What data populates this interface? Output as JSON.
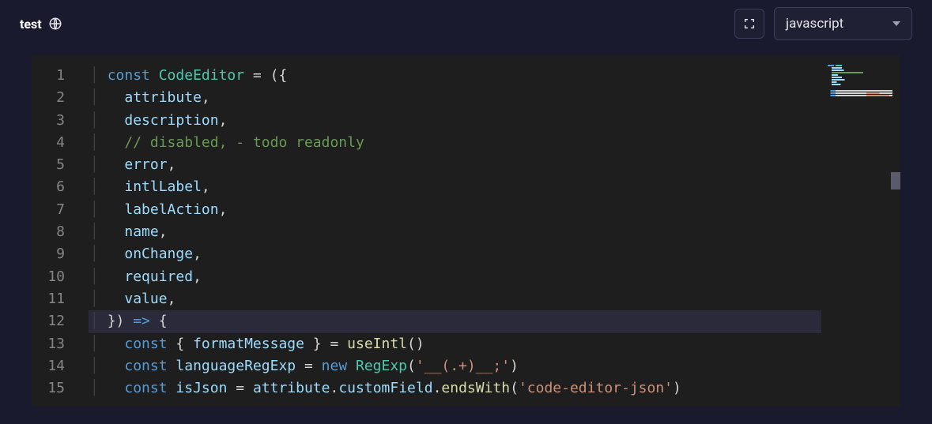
{
  "header": {
    "title": "test",
    "language_selected": "javascript"
  },
  "code": {
    "current_line": 12,
    "lines": [
      {
        "n": 1,
        "tokens": [
          [
            "kw",
            "const"
          ],
          [
            "pn",
            " "
          ],
          [
            "cls",
            "CodeEditor"
          ],
          [
            "pn",
            " = ({"
          ]
        ]
      },
      {
        "n": 2,
        "tokens": [
          [
            "pn",
            "  "
          ],
          [
            "id",
            "attribute"
          ],
          [
            "pn",
            ","
          ]
        ]
      },
      {
        "n": 3,
        "tokens": [
          [
            "pn",
            "  "
          ],
          [
            "id",
            "description"
          ],
          [
            "pn",
            ","
          ]
        ]
      },
      {
        "n": 4,
        "tokens": [
          [
            "pn",
            "  "
          ],
          [
            "cm",
            "// disabled, - todo readonly"
          ]
        ]
      },
      {
        "n": 5,
        "tokens": [
          [
            "pn",
            "  "
          ],
          [
            "id",
            "error"
          ],
          [
            "pn",
            ","
          ]
        ]
      },
      {
        "n": 6,
        "tokens": [
          [
            "pn",
            "  "
          ],
          [
            "id",
            "intlLabel"
          ],
          [
            "pn",
            ","
          ]
        ]
      },
      {
        "n": 7,
        "tokens": [
          [
            "pn",
            "  "
          ],
          [
            "id",
            "labelAction"
          ],
          [
            "pn",
            ","
          ]
        ]
      },
      {
        "n": 8,
        "tokens": [
          [
            "pn",
            "  "
          ],
          [
            "id",
            "name"
          ],
          [
            "pn",
            ","
          ]
        ]
      },
      {
        "n": 9,
        "tokens": [
          [
            "pn",
            "  "
          ],
          [
            "id",
            "onChange"
          ],
          [
            "pn",
            ","
          ]
        ]
      },
      {
        "n": 10,
        "tokens": [
          [
            "pn",
            "  "
          ],
          [
            "id",
            "required"
          ],
          [
            "pn",
            ","
          ]
        ]
      },
      {
        "n": 11,
        "tokens": [
          [
            "pn",
            "  "
          ],
          [
            "id",
            "value"
          ],
          [
            "pn",
            ","
          ]
        ]
      },
      {
        "n": 12,
        "tokens": [
          [
            "pn",
            "}) "
          ],
          [
            "ar",
            "=>"
          ],
          [
            "pn",
            " {"
          ]
        ]
      },
      {
        "n": 13,
        "tokens": [
          [
            "pn",
            "  "
          ],
          [
            "kw",
            "const"
          ],
          [
            "pn",
            " { "
          ],
          [
            "id",
            "formatMessage"
          ],
          [
            "pn",
            " } = "
          ],
          [
            "fn",
            "useIntl"
          ],
          [
            "pn",
            "()"
          ]
        ]
      },
      {
        "n": 14,
        "tokens": [
          [
            "pn",
            "  "
          ],
          [
            "kw",
            "const"
          ],
          [
            "pn",
            " "
          ],
          [
            "id",
            "languageRegExp"
          ],
          [
            "pn",
            " = "
          ],
          [
            "kw",
            "new"
          ],
          [
            "pn",
            " "
          ],
          [
            "cls",
            "RegExp"
          ],
          [
            "pn",
            "("
          ],
          [
            "str",
            "'__(.+)__;'"
          ],
          [
            "pn",
            ")"
          ]
        ]
      },
      {
        "n": 15,
        "tokens": [
          [
            "pn",
            "  "
          ],
          [
            "kw",
            "const"
          ],
          [
            "pn",
            " "
          ],
          [
            "id",
            "isJson"
          ],
          [
            "pn",
            " = "
          ],
          [
            "id",
            "attribute"
          ],
          [
            "pn",
            "."
          ],
          [
            "id",
            "customField"
          ],
          [
            "pn",
            "."
          ],
          [
            "fn",
            "endsWith"
          ],
          [
            "pn",
            "("
          ],
          [
            "str",
            "'code-editor-json'"
          ],
          [
            "pn",
            ")"
          ]
        ]
      }
    ]
  }
}
